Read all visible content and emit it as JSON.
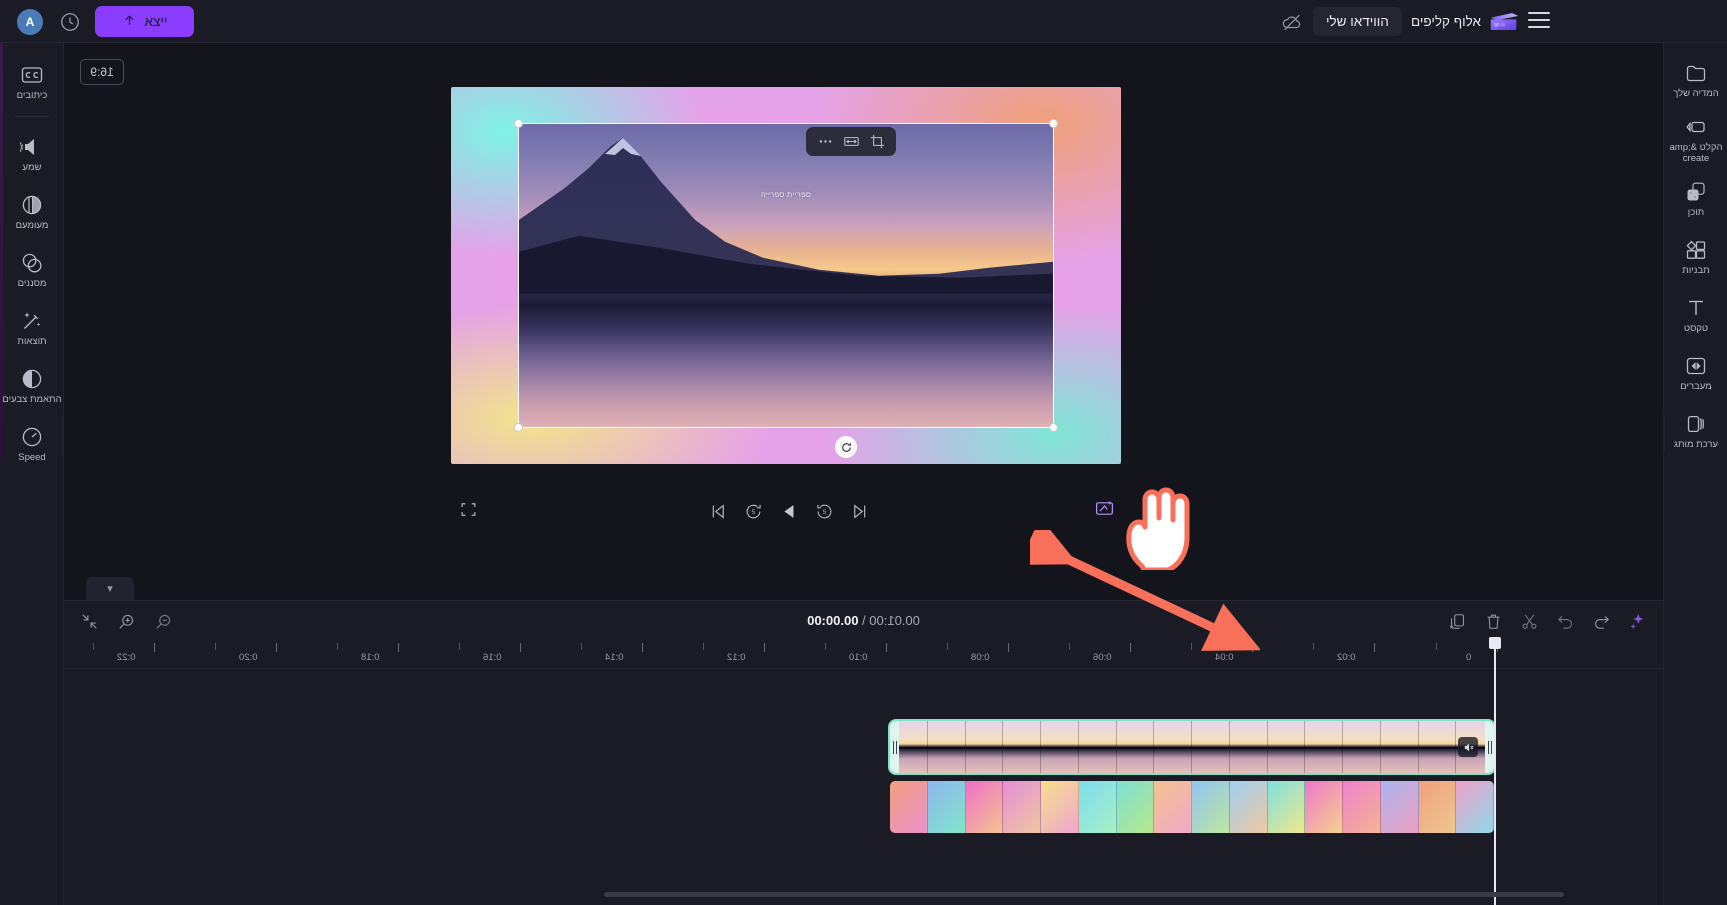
{
  "app": {
    "brand_name": "אלוף קליפים",
    "accent_purple": "#8b3dff",
    "selection_green": "#7fe3c6",
    "annotation_red": "#f9705a"
  },
  "topbar": {
    "avatar_initial": "A",
    "history_icon": "history-icon",
    "export_label": "ייצא",
    "export_icon": "upload-arrow-icon",
    "cloud_off_icon": "cloud-offline-icon",
    "my_video_label": "הווידאו שלי",
    "brand_icon": "clapperboard-icon",
    "menu_icon": "hamburger-menu-icon"
  },
  "left_rail": {
    "items": [
      {
        "label": "כיתובים",
        "icon": "captions-icon"
      },
      {
        "label": "שמע",
        "icon": "audio-volume-icon"
      },
      {
        "label": "מעומעם",
        "icon": "fade-icon"
      },
      {
        "label": "מסננים",
        "icon": "filters-icon"
      },
      {
        "label": "תוצאות",
        "icon": "effects-wand-icon"
      },
      {
        "label": "התאמת צבעים",
        "icon": "color-adjust-icon"
      },
      {
        "label": "Speed",
        "icon": "speed-gauge-icon"
      }
    ]
  },
  "right_rail": {
    "items": [
      {
        "label": "המדיה שלך",
        "icon": "media-folder-icon"
      },
      {
        "label": "הקלט &amp; create",
        "icon": "record-create-icon"
      },
      {
        "label": "תוכן",
        "icon": "content-dice-icon"
      },
      {
        "label": "תבניות",
        "icon": "templates-grid-icon"
      },
      {
        "label": "טקסט",
        "icon": "text-t-icon"
      },
      {
        "label": "מעברים",
        "icon": "transitions-icon"
      },
      {
        "label": "ערכת מותג",
        "icon": "brand-kit-icon"
      }
    ]
  },
  "preview": {
    "aspect_ratio_label": "16:9",
    "overlay_text": "ספריית ספרייה",
    "float_toolbar": [
      {
        "icon": "more-dots-icon",
        "name": "more-options"
      },
      {
        "icon": "fit-width-icon",
        "name": "fit-to-frame"
      },
      {
        "icon": "crop-icon",
        "name": "crop"
      }
    ],
    "rotate_handle_icon": "rotate-icon"
  },
  "playback": {
    "fullscreen_icon": "fullscreen-icon",
    "controls": [
      {
        "icon": "skip-to-start-icon",
        "name": "skip-to-start"
      },
      {
        "icon": "rewind-5s-icon",
        "name": "rewind-5-seconds"
      },
      {
        "icon": "play-icon",
        "name": "play"
      },
      {
        "icon": "forward-5s-icon",
        "name": "forward-5-seconds"
      },
      {
        "icon": "skip-to-end-icon",
        "name": "skip-to-end"
      }
    ],
    "ai_icon": "ai-sparkle-icon"
  },
  "timeline": {
    "tab_icon": "chevron-down-icon",
    "left_controls": [
      {
        "icon": "fit-timeline-icon",
        "name": "fit-timeline"
      },
      {
        "icon": "zoom-in-icon",
        "name": "zoom-in"
      },
      {
        "icon": "zoom-out-icon",
        "name": "zoom-out"
      }
    ],
    "current_time": "00.00:00",
    "separator": " \\ ",
    "total_time": "00.01:00",
    "right_controls": [
      {
        "icon": "duplicate-icon",
        "name": "duplicate-clip"
      },
      {
        "icon": "trash-icon",
        "name": "delete-clip"
      },
      {
        "icon": "scissors-icon",
        "name": "split-clip"
      },
      {
        "icon": "undo-icon",
        "name": "undo"
      },
      {
        "icon": "redo-icon",
        "name": "redo"
      },
      {
        "icon": "ai-sparkle-icon",
        "name": "ai-tools"
      }
    ],
    "ruler_labels": [
      "0:22",
      "0:20",
      "0:18",
      "0:16",
      "0:14",
      "0:12",
      "0:10",
      "0:08",
      "0:06",
      "0:04",
      "0:02",
      "0"
    ],
    "clips": [
      {
        "name": "video-clip",
        "selected": true,
        "badge_icon": "audio-muted-icon"
      },
      {
        "name": "gradient-background-clip",
        "selected": false
      }
    ]
  },
  "annotations": {
    "cursor_icon": "pointing-hand-cursor",
    "arrow_icon": "double-headed-arrow"
  }
}
